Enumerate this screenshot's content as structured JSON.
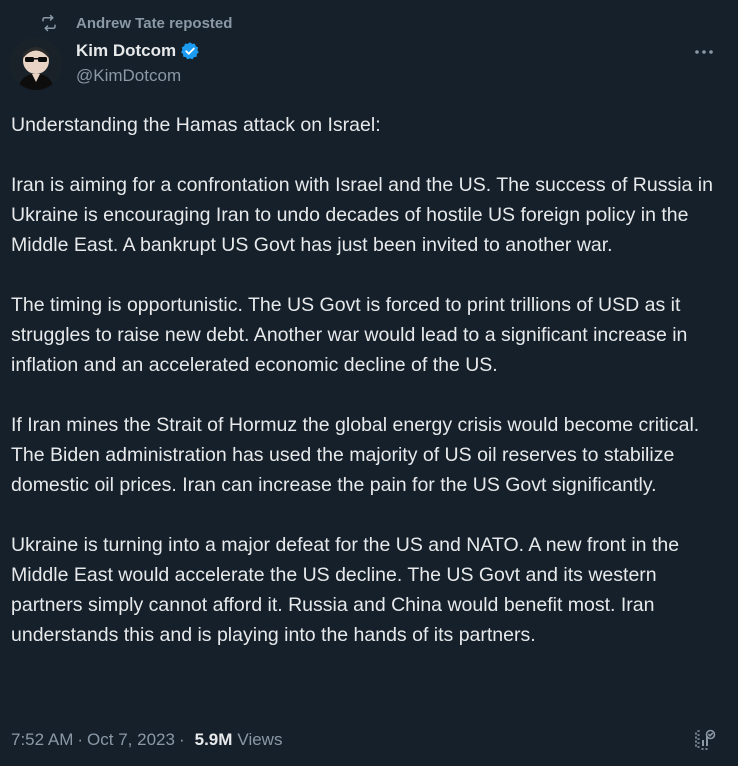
{
  "repost": {
    "text": "Andrew Tate reposted",
    "icon": "repost-icon"
  },
  "author": {
    "display_name": "Kim Dotcom",
    "handle": "@KimDotcom",
    "verified_icon": "verified-badge-icon",
    "verified_color": "#1d9bf0"
  },
  "menu": {
    "icon": "more-options-icon"
  },
  "body": {
    "paragraphs": [
      "Understanding the Hamas attack on Israel:",
      "Iran is aiming for a confrontation with Israel and the US. The success of Russia in Ukraine is encouraging Iran to undo decades of hostile US foreign policy in the Middle East. A bankrupt US Govt has just been invited to another war.",
      "The timing is opportunistic. The US Govt is forced to print trillions of USD as it struggles to raise new debt. Another war would lead to a significant increase in inflation and an accelerated economic decline of the US.",
      "If Iran mines the Strait of Hormuz the global energy crisis would become critical. The Biden administration has used the majority of US oil reserves to stabilize domestic oil prices. Iran can increase the pain for the US Govt significantly.",
      "Ukraine is turning into a major defeat for the US and NATO. A new front in the Middle East would accelerate the US decline. The US Govt and its western partners simply cannot afford it. Russia and China would benefit most. Iran understands this and is playing into the hands of its partners."
    ]
  },
  "meta": {
    "time": "7:52 AM",
    "separator": "·",
    "date": "Oct 7, 2023",
    "views_count": "5.9M",
    "views_label": "Views",
    "analytics_icon": "analytics-icon"
  },
  "colors": {
    "background": "#15202b",
    "text_primary": "#e7e9ea",
    "text_secondary": "#8b98a5",
    "accent": "#1d9bf0"
  }
}
